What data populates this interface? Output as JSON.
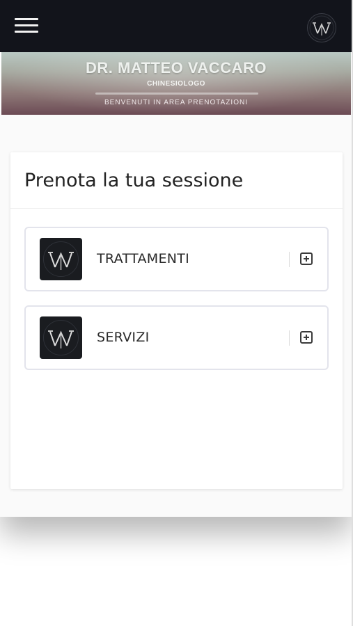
{
  "header": {
    "menu_icon": "hamburger-icon",
    "logo_icon": "m-monogram-logo-icon"
  },
  "banner": {
    "title": "DR. MATTEO VACCARO",
    "subtitle": "CHINESIOLOGO",
    "welcome": "BENVENUTI IN AREA PRENOTAZIONI"
  },
  "booking": {
    "title": "Prenota la tua sessione",
    "items": [
      {
        "label": "TRATTAMENTI",
        "icon": "m-monogram-logo-icon",
        "toggle_icon": "plus-square-icon"
      },
      {
        "label": "SERVIZI",
        "icon": "m-monogram-logo-icon",
        "toggle_icon": "plus-square-icon"
      }
    ]
  },
  "colors": {
    "topbar": "#12141b",
    "card_border": "#e3e4ec",
    "text_dark": "#232323"
  }
}
